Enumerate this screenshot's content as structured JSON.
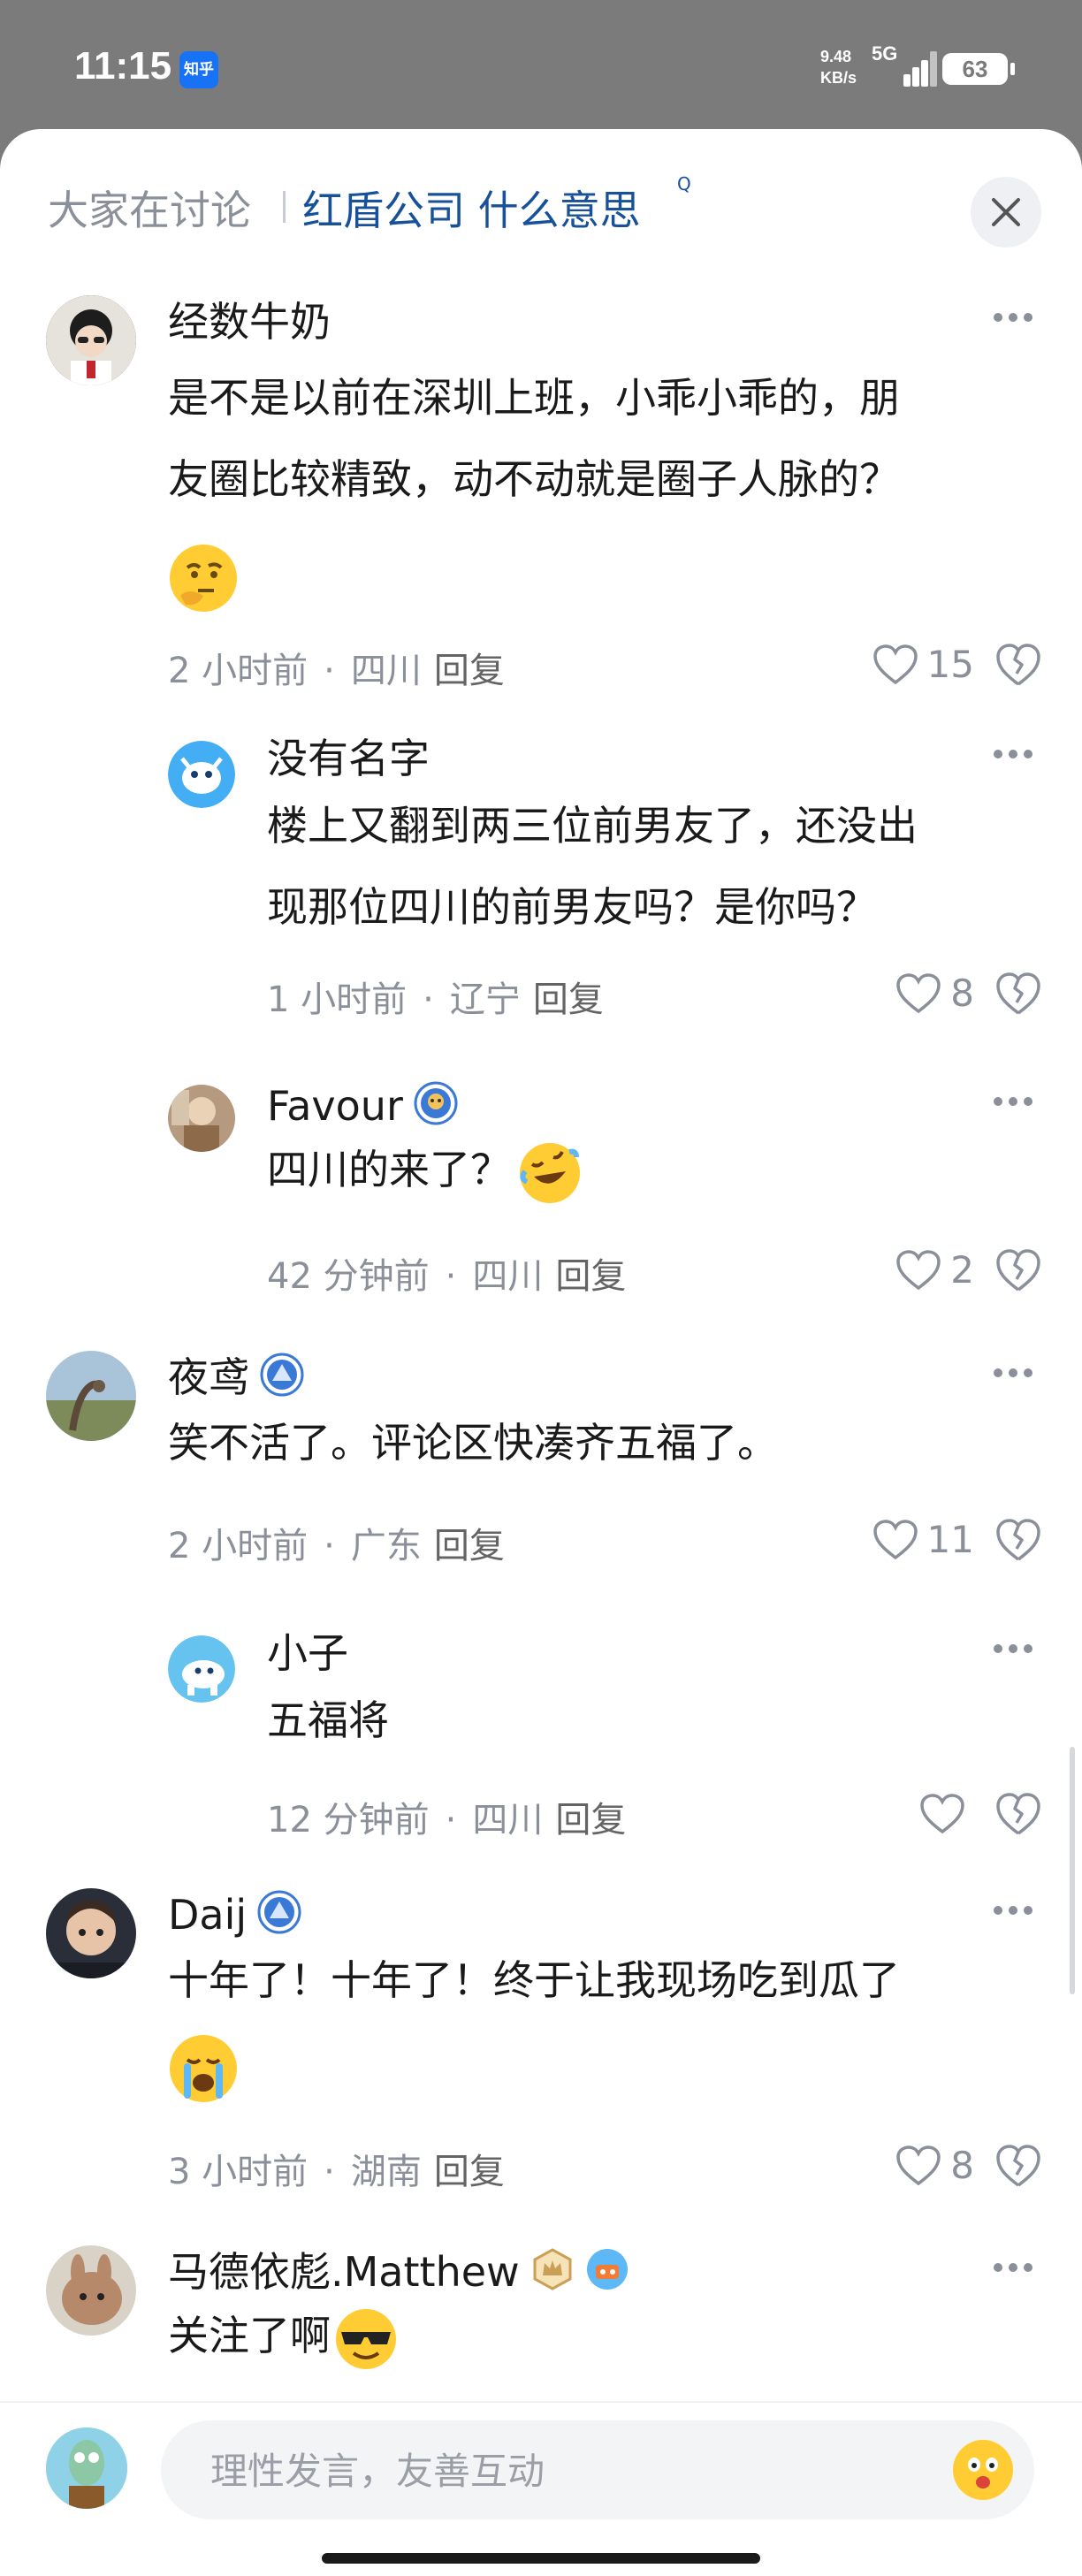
{
  "status": {
    "time": "11:15",
    "app_badge": "知乎",
    "net_speed": "9.48",
    "net_unit": "KB/s",
    "network": "5G",
    "battery": "63"
  },
  "header": {
    "prefix": "大家在讨论",
    "topic": "红盾公司 什么意思",
    "search_mark": "Q"
  },
  "comments": [
    {
      "user": "经数牛奶",
      "text": [
        "是不是以前在深圳上班，小乖小乖的，朋",
        "友圈比较精致，动不动就是圈子人脉的？"
      ],
      "emoji": "thinking-emoji",
      "time": "2 小时前",
      "region": "四川",
      "reply": "回复",
      "likes": "15"
    },
    {
      "user": "没有名字",
      "text": [
        "楼上又翻到两三位前男友了，还没出",
        "现那位四川的前男友吗？是你吗？"
      ],
      "time": "1 小时前",
      "region": "辽宁",
      "reply": "回复",
      "likes": "8"
    },
    {
      "user": "Favour",
      "text": [
        "四川的来了？"
      ],
      "emoji": "rofl-emoji",
      "time": "42 分钟前",
      "region": "四川",
      "reply": "回复",
      "likes": "2"
    },
    {
      "user": "夜鸢",
      "text": [
        "笑不活了。评论区快凑齐五福了。"
      ],
      "time": "2 小时前",
      "region": "广东",
      "reply": "回复",
      "likes": "11"
    },
    {
      "user": "小子",
      "text": [
        "五福将"
      ],
      "time": "12 分钟前",
      "region": "四川",
      "reply": "回复",
      "likes": ""
    },
    {
      "user": "Daij",
      "text": [
        "十年了！十年了！终于让我现场吃到瓜了"
      ],
      "emoji": "crying-emoji",
      "time": "3 小时前",
      "region": "湖南",
      "reply": "回复",
      "likes": "8"
    },
    {
      "user": "马德依彪.Matthew",
      "text": [
        "关注了啊"
      ],
      "emoji": "sunglasses-emoji"
    }
  ],
  "input": {
    "placeholder": "理性发言，友善互动"
  }
}
